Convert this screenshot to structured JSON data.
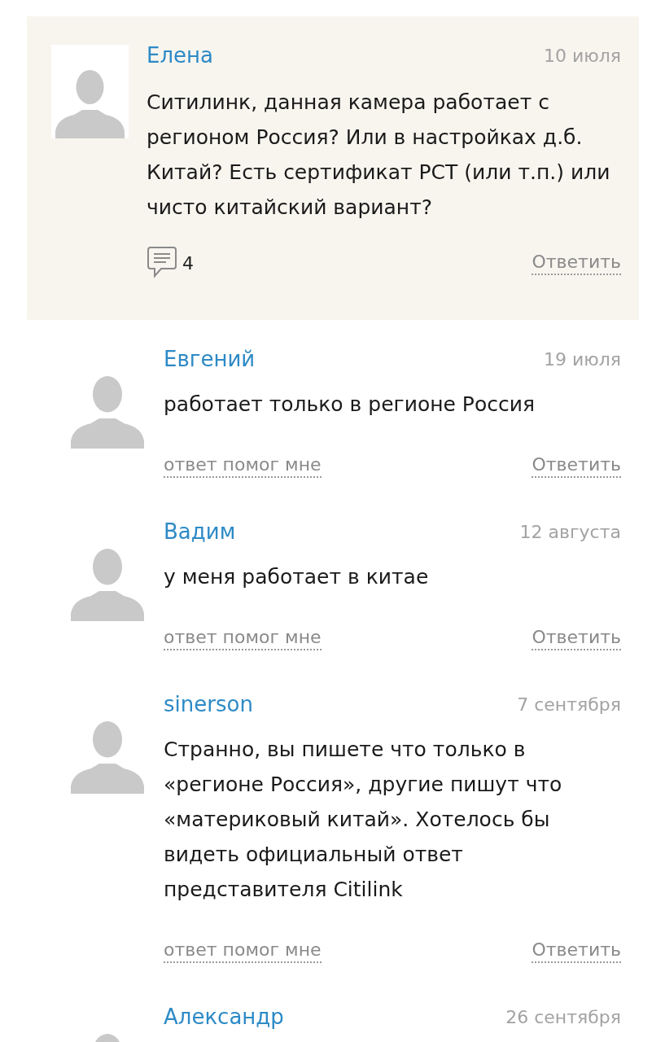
{
  "question": {
    "author": "Елена",
    "date": "10 июля",
    "text": "Ситилинк, данная камера работает с регионом Россия? Или в настройках д.б. Китай? Есть сертификат РСТ (или т.п.) или чисто китайский вариант?",
    "reply_count": "4",
    "reply_label": "Ответить"
  },
  "replies": [
    {
      "author": "Евгений",
      "date": "19 июля",
      "text": "работает только в регионе Россия",
      "helpful_label": "ответ помог мне",
      "reply_label": "Ответить"
    },
    {
      "author": "Вадим",
      "date": "12 августа",
      "text": "у меня работает в китае",
      "helpful_label": "ответ помог мне",
      "reply_label": "Ответить"
    },
    {
      "author": "sinerson",
      "date": "7 сентября",
      "text": "Странно, вы пишете что только в «регионе Россия», другие пишут что «материковый китай». Хотелось бы видеть официальный ответ представителя Citilink",
      "helpful_label": "ответ помог мне",
      "reply_label": "Ответить"
    },
    {
      "author": "Александр",
      "date": "26 сентября"
    }
  ]
}
